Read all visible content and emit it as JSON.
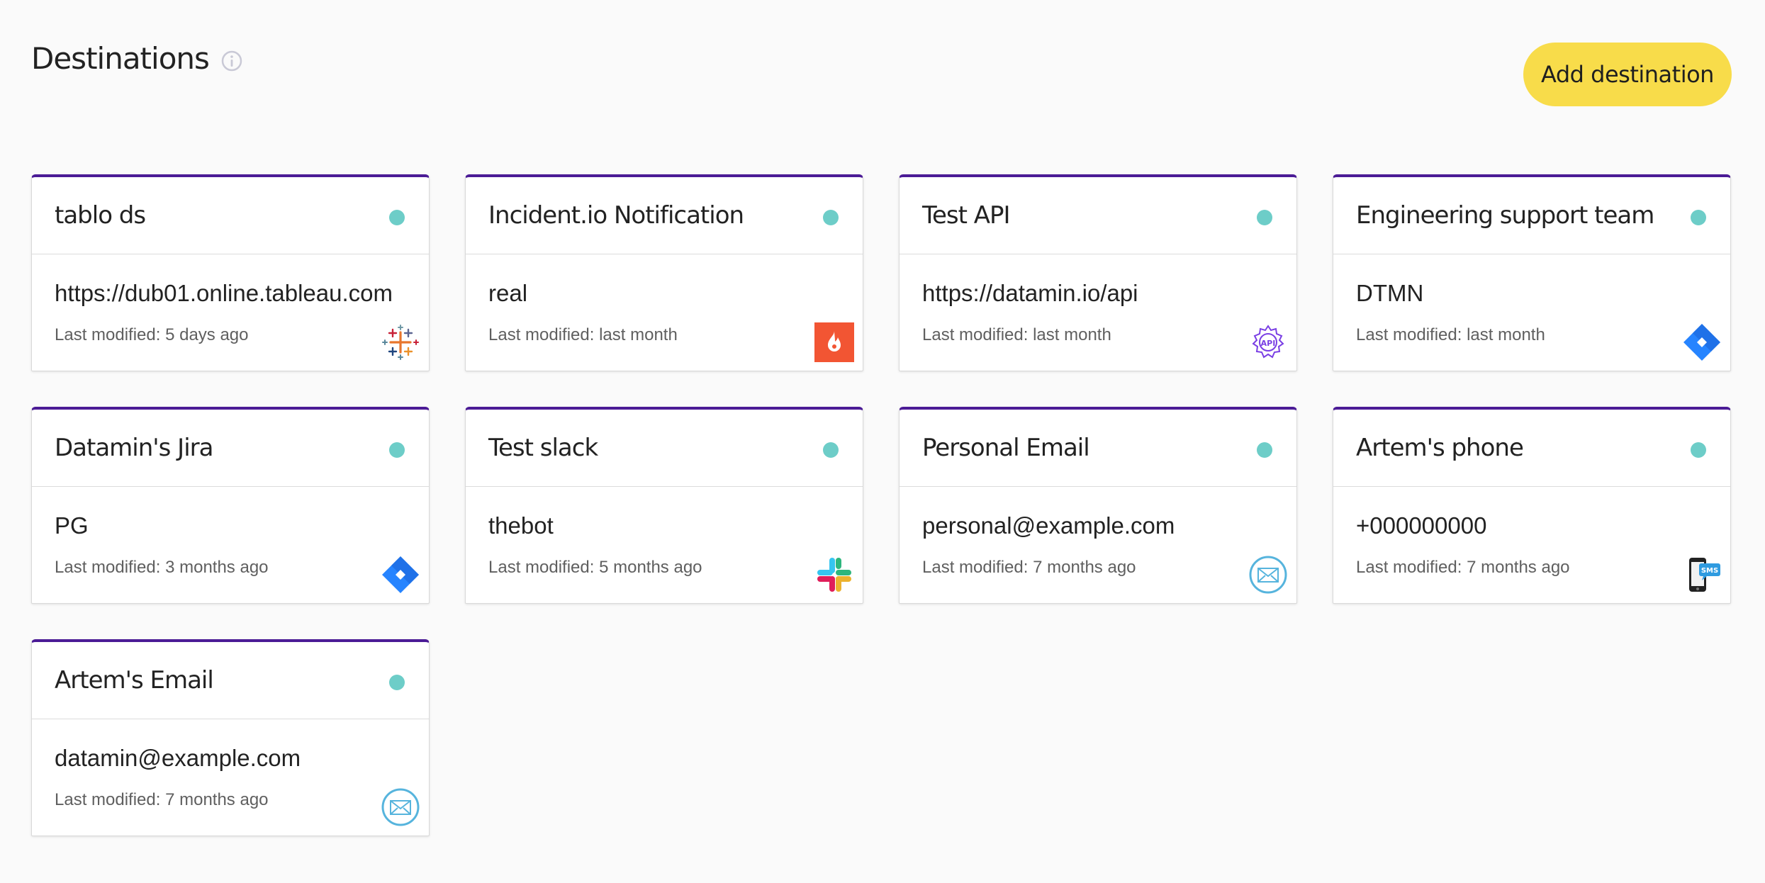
{
  "header": {
    "title": "Destinations",
    "add_button_label": "Add destination"
  },
  "colors": {
    "accent_top_border": "#4b1b96",
    "status_active": "#6dcdc8",
    "primary_button": "#f8dc4a"
  },
  "cards": [
    {
      "title": "tablo ds",
      "value": "https://dub01.online.tableau.com",
      "meta": "Last modified: 5 days ago",
      "icon": "tableau-icon"
    },
    {
      "title": "Incident.io Notification",
      "value": "real",
      "meta": "Last modified: last month",
      "icon": "incident-io-icon"
    },
    {
      "title": "Test API",
      "value": "https://datamin.io/api",
      "meta": "Last modified: last month",
      "icon": "api-gear-icon"
    },
    {
      "title": "Engineering support team",
      "value": "DTMN",
      "meta": "Last modified: last month",
      "icon": "jira-icon"
    },
    {
      "title": "Datamin's Jira",
      "value": "PG",
      "meta": "Last modified: 3 months ago",
      "icon": "jira-icon"
    },
    {
      "title": "Test slack",
      "value": "thebot",
      "meta": "Last modified: 5 months ago",
      "icon": "slack-icon"
    },
    {
      "title": "Personal Email",
      "value": "personal@example.com",
      "meta": "Last modified: 7 months ago",
      "icon": "email-icon"
    },
    {
      "title": "Artem's phone",
      "value": "+000000000",
      "meta": "Last modified: 7 months ago",
      "icon": "sms-phone-icon",
      "icon_text": "SMS"
    },
    {
      "title": "Artem's Email",
      "value": "datamin@example.com",
      "meta": "Last modified: 7 months ago",
      "icon": "email-icon"
    }
  ]
}
